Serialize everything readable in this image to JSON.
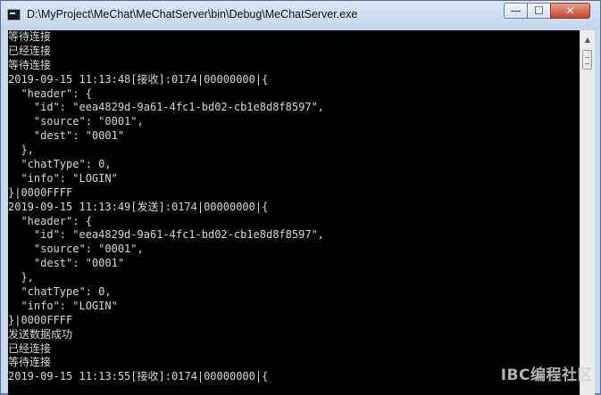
{
  "window": {
    "title": "D:\\MyProject\\MeChat\\MeChatServer\\bin\\Debug\\MeChatServer.exe",
    "buttons": {
      "minimize": "—",
      "maximize": "☐",
      "close": "✕"
    }
  },
  "console": {
    "lines": [
      "等待连接",
      "已经连接",
      "等待连接",
      "2019-09-15 11:13:48[接收]:0174|00000000|{",
      "  \"header\": {",
      "    \"id\": \"eea4829d-9a61-4fc1-bd02-cb1e8d8f8597\",",
      "    \"source\": \"0001\",",
      "    \"dest\": \"0001\"",
      "  },",
      "  \"chatType\": 0,",
      "  \"info\": \"LOGIN\"",
      "}|0000FFFF",
      "2019-09-15 11:13:49[发送]:0174|00000000|{",
      "  \"header\": {",
      "    \"id\": \"eea4829d-9a61-4fc1-bd02-cb1e8d8f8597\",",
      "    \"source\": \"0001\",",
      "    \"dest\": \"0001\"",
      "  },",
      "  \"chatType\": 0,",
      "  \"info\": \"LOGIN\"",
      "}|0000FFFF",
      "发送数据成功",
      "已经连接",
      "等待连接",
      "2019-09-15 11:13:55[接收]:0174|00000000|{"
    ]
  },
  "watermark": "IBC编程社区",
  "colors": {
    "console_bg": "#000000",
    "console_text": "#d8d8d8"
  }
}
